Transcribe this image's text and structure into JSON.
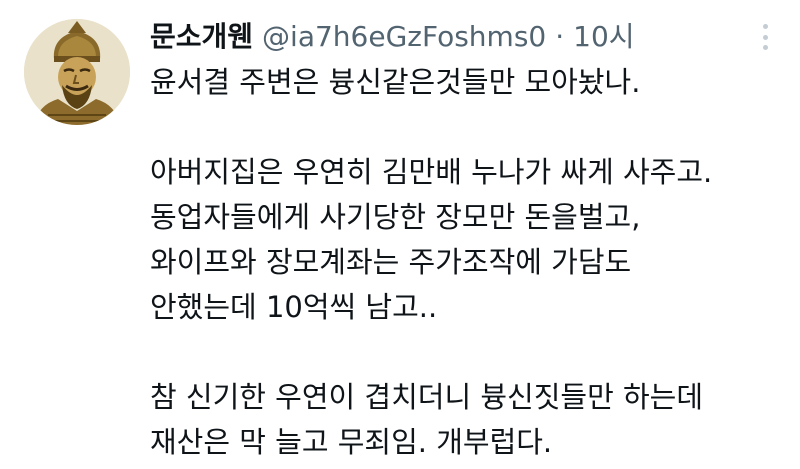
{
  "tweet": {
    "display_name": "문소개웬",
    "handle": "@ia7h6eGzFoshms0",
    "separator": "·",
    "timestamp": "10시",
    "avatar_icon": "warrior-statue-avatar-icon",
    "more_icon": "more-options-vertical-icon",
    "body": {
      "p1": [
        "윤서결 주변은 븅신같은것들만 모아놨나."
      ],
      "p2": [
        "아버지집은 우연히 김만배 누나가 싸게 사주고.",
        "동업자들에게 사기당한 장모만 돈을벌고,",
        "와이프와 장모계좌는 주가조작에 가담도",
        "안했는데 10억씩 남고.."
      ],
      "p3": [
        "참 신기한 우연이 겹치더니 븅신짓들만 하는데",
        "재산은 막 늘고 무죄임. 개부럽다."
      ]
    }
  }
}
